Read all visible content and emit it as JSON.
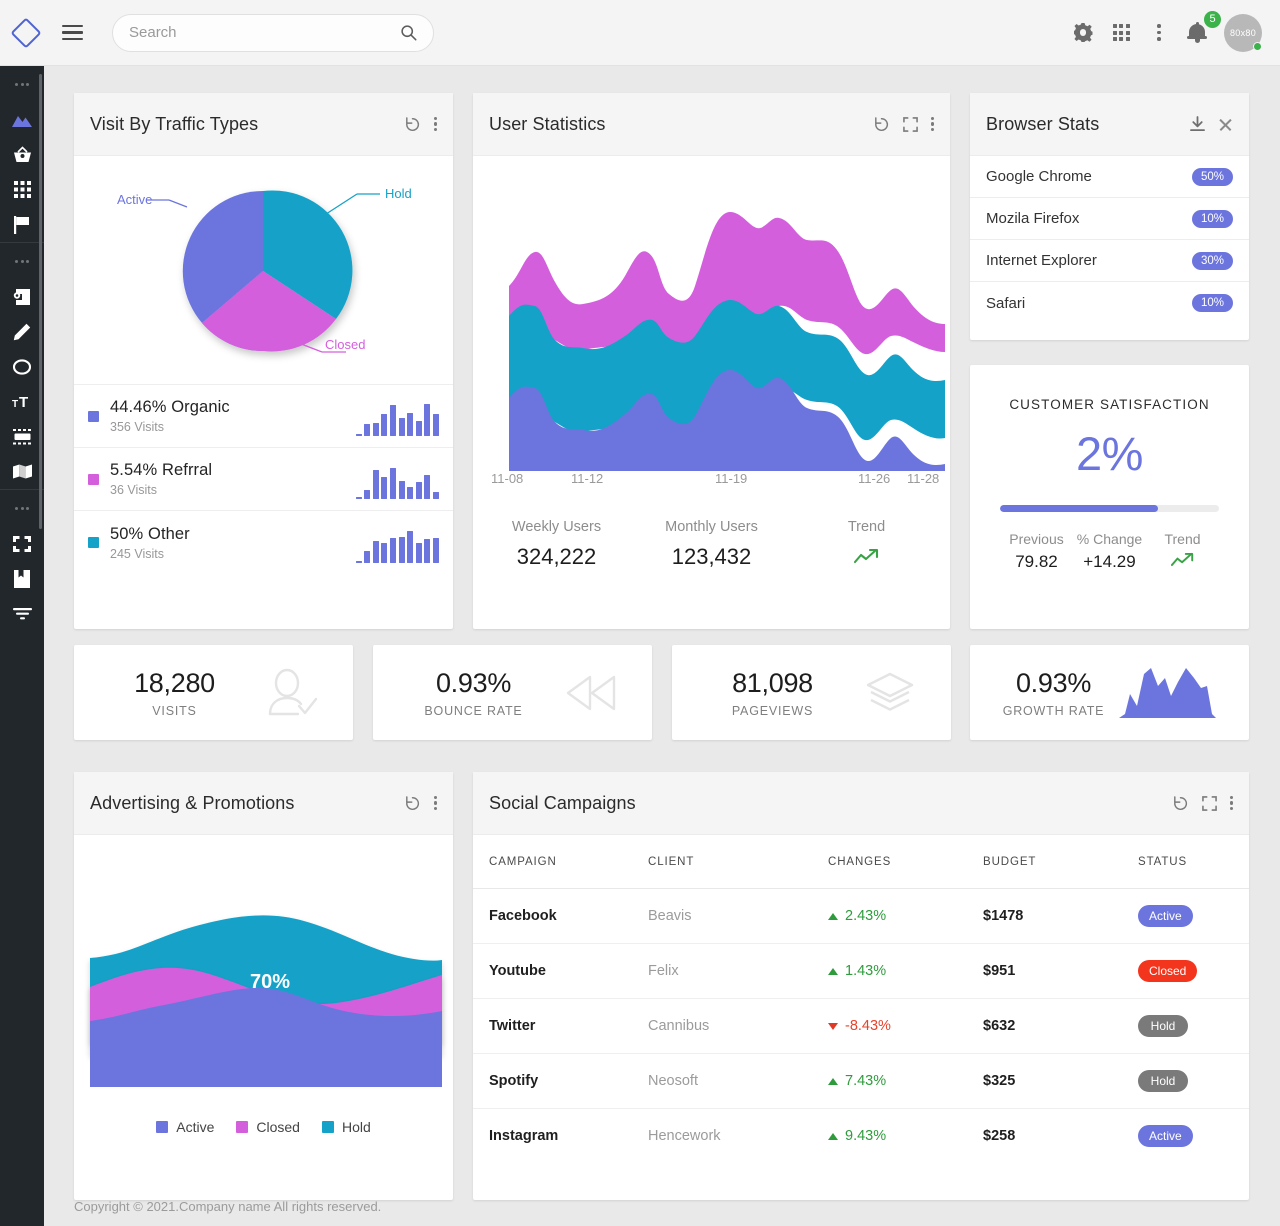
{
  "header": {
    "logo_icon": "diamond-logo",
    "menu_icon": "hamburger-menu-icon",
    "search": {
      "placeholder": "Search",
      "value": "",
      "icon": "search-icon"
    },
    "icons": [
      "gear-icon",
      "apps-grid-icon",
      "more-vertical-icon",
      "bell-icon"
    ],
    "notification_count": "5",
    "avatar_label": "80x80"
  },
  "sidebar": {
    "groups": [
      {
        "divider": "...",
        "items": [
          {
            "icon": "mountains-icon",
            "active": true
          },
          {
            "icon": "basket-icon",
            "active": false
          },
          {
            "icon": "grid-apps-icon",
            "active": false
          },
          {
            "icon": "flag-icon",
            "active": false
          }
        ]
      },
      {
        "divider": "...",
        "items": [
          {
            "icon": "login-box-icon",
            "active": false
          },
          {
            "icon": "pencil-icon",
            "active": false
          },
          {
            "icon": "circle-icon",
            "active": false
          },
          {
            "icon": "text-size-icon",
            "active": false
          },
          {
            "icon": "widgets-icon",
            "active": false
          },
          {
            "icon": "map-icon",
            "active": false
          }
        ]
      },
      {
        "divider": "...",
        "items": [
          {
            "icon": "fullscreen-icon",
            "active": false
          },
          {
            "icon": "book-icon",
            "active": false
          },
          {
            "icon": "filter-icon",
            "active": false
          }
        ]
      }
    ]
  },
  "traffic_card": {
    "title": "Visit By Traffic Types",
    "actions": [
      "reload-icon",
      "more-vertical-icon"
    ],
    "legend": [
      {
        "percent": "44.46%",
        "name": "Organic",
        "visits": "356 Visits",
        "color": "#6c75dd"
      },
      {
        "percent": "5.54%",
        "name": "Refrral",
        "visits": "36 Visits",
        "color": "#d45fdd"
      },
      {
        "percent": "50%",
        "name": "Other",
        "visits": "245 Visits",
        "color": "#14a2c8"
      }
    ],
    "sparklines": [
      [
        2,
        30,
        32,
        55,
        78,
        45,
        58,
        38,
        80,
        55
      ],
      [
        2,
        22,
        72,
        55,
        78,
        45,
        30,
        42,
        60,
        18
      ],
      [
        2,
        28,
        55,
        48,
        62,
        65,
        78,
        48,
        58,
        62
      ]
    ]
  },
  "userstats_card": {
    "title": "User Statistics",
    "actions": [
      "reload-icon",
      "expand-icon",
      "more-vertical-icon"
    ],
    "axis_labels": [
      "11-08",
      "11-12",
      "11-19",
      "11-26",
      "11-28"
    ],
    "kpis": [
      {
        "label": "Weekly Users",
        "value": "324,222"
      },
      {
        "label": "Monthly Users",
        "value": "123,432"
      },
      {
        "label": "Trend",
        "value": "",
        "icon": "trend-up-icon"
      }
    ]
  },
  "browser_card": {
    "title": "Browser Stats",
    "actions": [
      "download-icon",
      "close-icon"
    ],
    "rows": [
      {
        "name": "Google Chrome",
        "value": "50%"
      },
      {
        "name": "Mozila Firefox",
        "value": "10%"
      },
      {
        "name": "Internet Explorer",
        "value": "30%"
      },
      {
        "name": "Safari",
        "value": "10%"
      }
    ]
  },
  "csat_card": {
    "title": "CUSTOMER SATISFACTION",
    "big_value": "2%",
    "progress_percent": 72,
    "foot": [
      {
        "label": "Previous",
        "value": "79.82"
      },
      {
        "label": "% Change",
        "value": "+14.29"
      },
      {
        "label": "Trend",
        "value": "",
        "icon": "trend-up-icon"
      }
    ]
  },
  "kpi_cards": [
    {
      "value": "18,280",
      "caption": "VISITS",
      "icon": "user-check-icon"
    },
    {
      "value": "0.93%",
      "caption": "BOUNCE RATE",
      "icon": "rewind-icon"
    },
    {
      "value": "81,098",
      "caption": "PAGEVIEWS",
      "icon": "layers-icon"
    },
    {
      "value": "0.93%",
      "caption": "GROWTH RATE",
      "icon": "area-sparkline-icon"
    }
  ],
  "ads_card": {
    "title": "Advertising & Promotions",
    "actions": [
      "reload-icon",
      "more-vertical-icon"
    ],
    "overlay_label": "70%",
    "legend": [
      {
        "label": "Active",
        "color": "#6c75dd"
      },
      {
        "label": "Closed",
        "color": "#d45fdd"
      },
      {
        "label": "Hold",
        "color": "#14a2c8"
      }
    ]
  },
  "social_card": {
    "title": "Social Campaigns",
    "actions": [
      "reload-icon",
      "expand-icon",
      "more-vertical-icon"
    ],
    "columns": [
      "CAMPAIGN",
      "CLIENT",
      "CHANGES",
      "BUDGET",
      "STATUS"
    ],
    "rows": [
      {
        "campaign": "Facebook",
        "client": "Beavis",
        "change": "2.43%",
        "dir": "up",
        "budget": "$1478",
        "status": "Active",
        "status_kind": "active"
      },
      {
        "campaign": "Youtube",
        "client": "Felix",
        "change": "1.43%",
        "dir": "up",
        "budget": "$951",
        "status": "Closed",
        "status_kind": "closed"
      },
      {
        "campaign": "Twitter",
        "client": "Cannibus",
        "change": "-8.43%",
        "dir": "down",
        "budget": "$632",
        "status": "Hold",
        "status_kind": "hold"
      },
      {
        "campaign": "Spotify",
        "client": "Neosoft",
        "change": "7.43%",
        "dir": "up",
        "budget": "$325",
        "status": "Hold",
        "status_kind": "hold"
      },
      {
        "campaign": "Instagram",
        "client": "Hencework",
        "change": "9.43%",
        "dir": "up",
        "budget": "$258",
        "status": "Active",
        "status_kind": "active"
      }
    ]
  },
  "footer": {
    "text": "Copyright © 2021.Company name All rights reserved."
  },
  "chart_data": [
    {
      "type": "pie",
      "title": "Visit By Traffic Types",
      "labels": [
        "Active",
        "Hold",
        "Closed"
      ],
      "values": [
        40,
        30,
        30
      ],
      "colors": [
        "#6c75dd",
        "#14a2c8",
        "#d45fdd"
      ],
      "legend": "callout-lines"
    },
    {
      "type": "area",
      "title": "User Statistics",
      "x": [
        "11-08",
        "11-12",
        "11-19",
        "11-26",
        "11-28"
      ],
      "series": [
        {
          "name": "band-purple",
          "color": "#6c75dd"
        },
        {
          "name": "band-cyan",
          "color": "#14a2c8"
        },
        {
          "name": "band-magenta",
          "color": "#d45fdd"
        }
      ],
      "style": "streamgraph",
      "grid": false
    },
    {
      "type": "bar",
      "title": "Browser Stats",
      "categories": [
        "Google Chrome",
        "Mozila Firefox",
        "Internet Explorer",
        "Safari"
      ],
      "values": [
        50,
        10,
        30,
        10
      ],
      "ylabel": "%",
      "ylim": [
        0,
        100
      ]
    },
    {
      "type": "area",
      "title": "Advertising & Promotions",
      "categories": [
        "Active",
        "Closed",
        "Hold"
      ],
      "colors": [
        "#6c75dd",
        "#d45fdd",
        "#14a2c8"
      ],
      "annotation": "70%",
      "style": "stacked-smooth",
      "grid": false
    }
  ]
}
